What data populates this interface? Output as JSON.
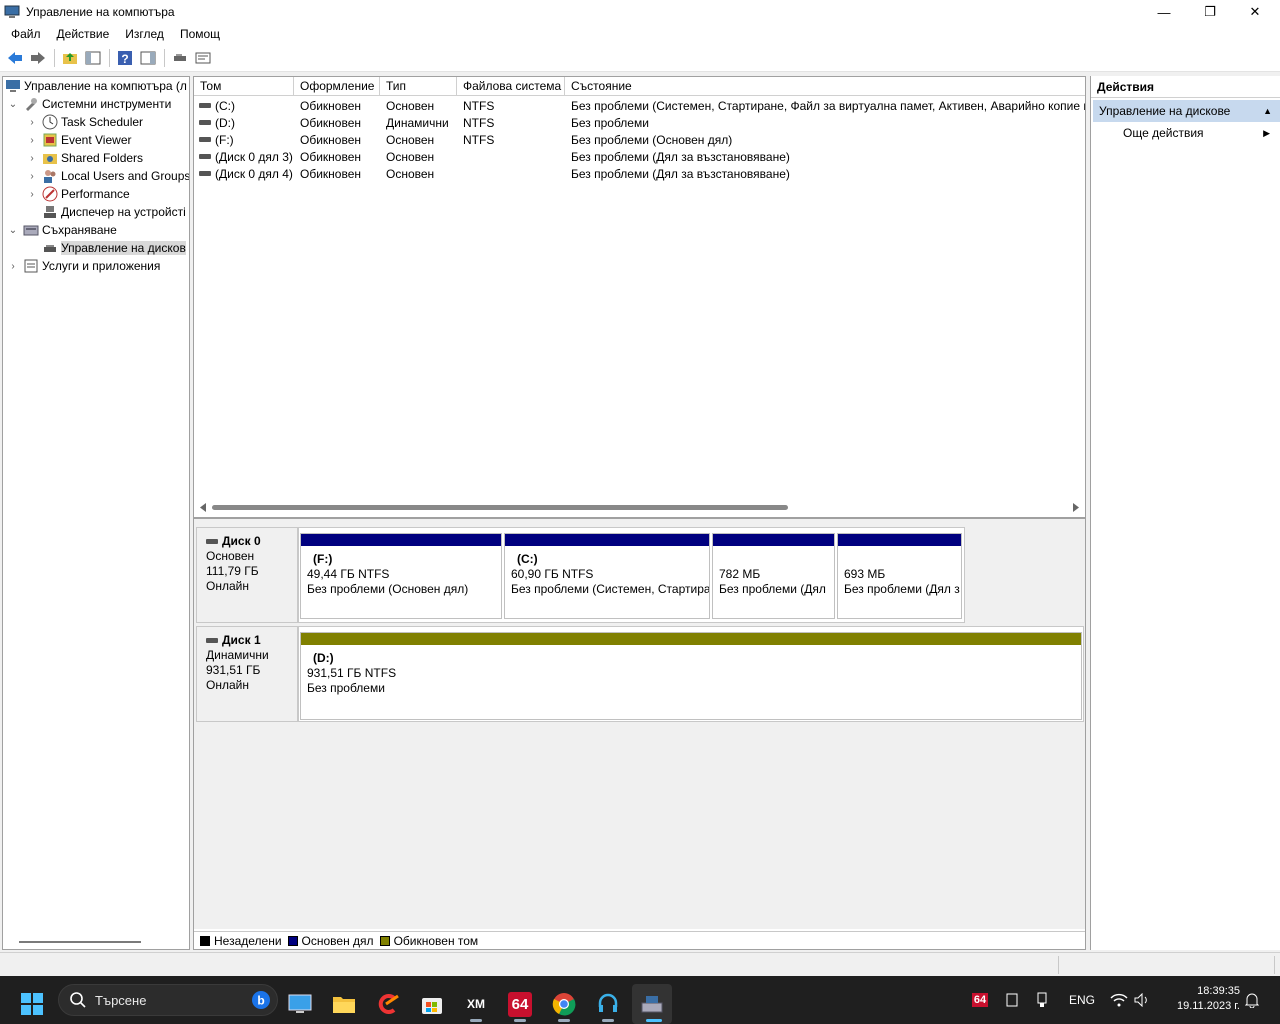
{
  "window": {
    "title": "Управление на компютъра",
    "controls": {
      "minimize": "—",
      "maximize": "❐",
      "close": "✕"
    }
  },
  "menu": [
    "Файл",
    "Действие",
    "Изглед",
    "Помощ"
  ],
  "toolbar": {
    "icons": [
      "back-arrow-icon",
      "forward-arrow-icon",
      "up-folder-icon",
      "show-hide-tree-icon",
      "help-icon",
      "show-hide-action-icon",
      "disk-icon",
      "properties-icon"
    ]
  },
  "tree": {
    "root": "Управление на компютъра (л",
    "system_tools": "Системни инструменти",
    "task_scheduler": "Task Scheduler",
    "event_viewer": "Event Viewer",
    "shared_folders": "Shared Folders",
    "local_users": "Local Users and Groups",
    "performance": "Performance",
    "device_manager": "Диспечер на устройсті",
    "storage": "Съхраняване",
    "disk_management": "Управление на дисков",
    "services": "Услуги и приложения"
  },
  "volumes": {
    "headers": [
      "Том",
      "Оформление",
      "Тип",
      "Файлова система",
      "Състояние"
    ],
    "rows": [
      [
        "(C:)",
        "Обикновен",
        "Основен",
        "NTFS",
        "Без проблеми (Системен, Стартиране, Файл за виртуална памет, Активен, Аварийно копие на"
      ],
      [
        "(D:)",
        "Обикновен",
        "Динамични",
        "NTFS",
        "Без проблеми"
      ],
      [
        "(F:)",
        "Обикновен",
        "Основен",
        "NTFS",
        "Без проблеми (Основен дял)"
      ],
      [
        "(Диск 0 дял 3)",
        "Обикновен",
        "Основен",
        "",
        "Без проблеми (Дял за възстановяване)"
      ],
      [
        "(Диск 0 дял 4)",
        "Обикновен",
        "Основен",
        "",
        "Без проблеми (Дял за възстановяване)"
      ]
    ]
  },
  "disks": [
    {
      "name": "Диск 0",
      "type": "Основен",
      "size": "111,79 ГБ",
      "status": "Онлайн",
      "partitions": [
        {
          "name": "(F:)",
          "size": "49,44 ГБ NTFS",
          "status": "Без проблеми (Основен дял)"
        },
        {
          "name": "(C:)",
          "size": "60,90 ГБ NTFS",
          "status": "Без проблеми (Системен, Стартира"
        },
        {
          "name": "",
          "size": "782 МБ",
          "status": "Без проблеми (Дял"
        },
        {
          "name": "",
          "size": "693 МБ",
          "status": "Без проблеми (Дял з"
        }
      ]
    },
    {
      "name": "Диск 1",
      "type": "Динамични",
      "size": "931,51 ГБ",
      "status": "Онлайн",
      "partitions": [
        {
          "name": "(D:)",
          "size": "931,51 ГБ NTFS",
          "status": "Без проблеми"
        }
      ]
    }
  ],
  "legend": [
    {
      "label": "Незаделени",
      "color": "#000000"
    },
    {
      "label": "Основен дял",
      "color": "#00007f"
    },
    {
      "label": "Обикновен том",
      "color": "#808000"
    }
  ],
  "actions": {
    "header": "Действия",
    "section": "Управление на дискове",
    "more": "Още действия"
  },
  "taskbar": {
    "search_placeholder": "Търсене",
    "apps": [
      "windows-start-icon",
      "bing-icon",
      "remote-desktop-icon",
      "file-explorer-icon",
      "ccleaner-icon",
      "microsoft-store-icon",
      "xmplay-icon",
      "aida64-icon",
      "chrome-icon",
      "headset-icon",
      "disk-management-icon"
    ],
    "aida_label": "64",
    "xm_label": "XM",
    "tray_aida": "64",
    "language": "ENG",
    "time": "18:39:35",
    "date": "19.11.2023 г."
  },
  "colors": {
    "primary_partition": "#00007f",
    "simple_volume": "#808000",
    "selection": "#c7d9ee"
  }
}
